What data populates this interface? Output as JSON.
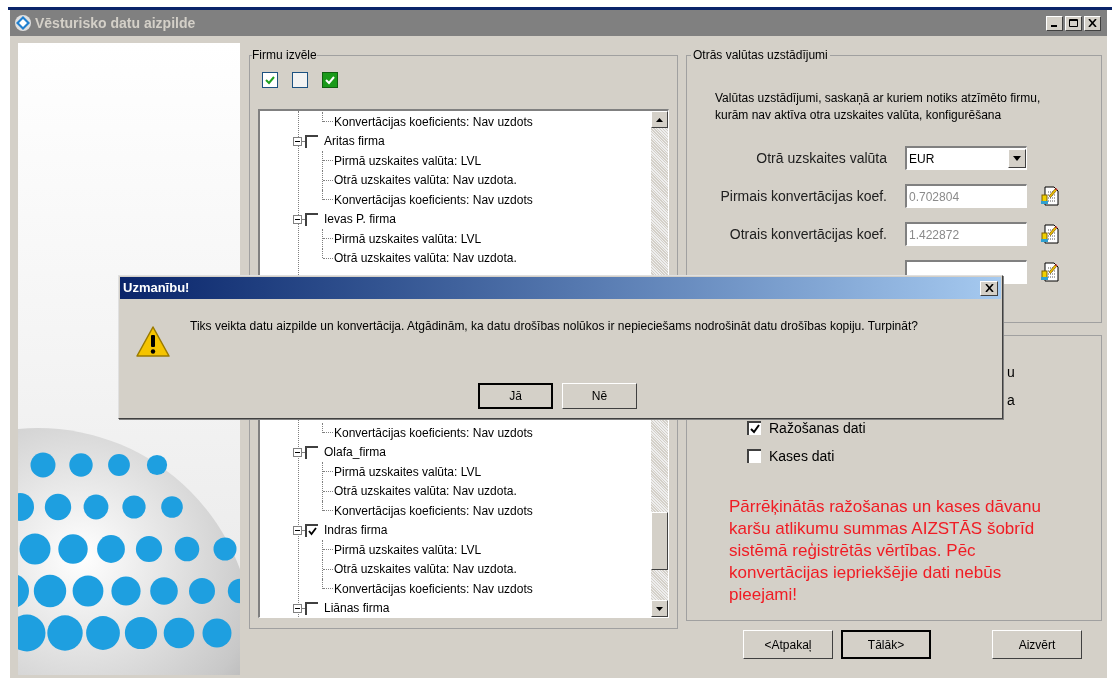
{
  "window": {
    "title": "Vēsturisko datu aizpilde"
  },
  "firm_selection": {
    "title": "Firmu izvēle",
    "tree": {
      "rows_above": [
        {
          "children": [
            "Konvertācijas koeficients: Nav uzdots"
          ]
        },
        {
          "label": "Aritas firma",
          "expanded": true,
          "checked": false,
          "children": [
            "Pirmā uzskaites valūta: LVL",
            "Otrā uzskaites valūta: Nav uzdota.",
            "Konvertācijas koeficients: Nav uzdots"
          ]
        },
        {
          "label": "Ievas P. firma",
          "expanded": true,
          "checked": false,
          "children": [
            "Pirmā uzskaites valūta: LVL",
            "Otrā uzskaites valūta: Nav uzdota."
          ]
        }
      ],
      "rows_below": [
        {
          "children": [
            "Konvertācijas koeficients: Nav uzdots"
          ]
        },
        {
          "label": "Olafa_firma",
          "expanded": true,
          "checked": false,
          "children": [
            "Pirmā uzskaites valūta: LVL",
            "Otrā uzskaites valūta: Nav uzdota.",
            "Konvertācijas koeficients: Nav uzdots"
          ]
        },
        {
          "label": "Indras firma",
          "expanded": true,
          "checked": true,
          "children": [
            "Pirmā uzskaites valūta: LVL",
            "Otrā uzskaites valūta: Nav uzdota.",
            "Konvertācijas koeficients: Nav uzdots"
          ]
        },
        {
          "label": "Liānas firma",
          "expanded": true,
          "checked": false
        }
      ]
    }
  },
  "currency_settings": {
    "title": "Otrās valūtas uzstādījumi",
    "description": "Valūtas uzstādījumi, saskaņā ar kuriem notiks atzīmēto firmu, kurām nav aktīva otra uzskaites valūta, konfigurēšana",
    "fields": [
      {
        "kind": "select",
        "label": "Otrā uzskaites valūta",
        "value": "EUR"
      },
      {
        "kind": "number",
        "label": "Pirmais konvertācijas koef.",
        "value": "0.702804",
        "disabled": true
      },
      {
        "kind": "number",
        "label": "Otrais konvertācijas koef.",
        "value": "1.422872",
        "disabled": true
      },
      {
        "kind": "number"
      }
    ]
  },
  "data_options": {
    "rows": [
      {
        "kind": "fragment",
        "text": "u"
      },
      {
        "kind": "fragment",
        "text": "a"
      },
      {
        "kind": "checkbox",
        "label": "Ražošanas dati",
        "checked": true
      },
      {
        "kind": "checkbox",
        "label": "Kases dati",
        "checked": false
      }
    ],
    "warning": "Pārrēķinātās ražošanas un kases dāvanu karšu atlikumu summas AIZSTĀS šobrīd sistēmā reģistrētās vērtības. Pēc konvertācijas iepriekšējie dati nebūs pieejami!"
  },
  "buttons": [
    {
      "label": "<Atpakaļ",
      "default": false
    },
    {
      "label": "Tālāk>",
      "default": true
    },
    {
      "label": "Aizvērt",
      "default": false
    }
  ],
  "dialog": {
    "title": "Uzmanību!",
    "message": "Tiks veikta datu aizpilde un konvertācija. Atgādinām, ka datu drošības nolūkos ir nepieciešams nodrošināt datu drošības kopiju. Turpināt?",
    "buttons": [
      {
        "label": "Jā",
        "default": true
      },
      {
        "label": "Nē",
        "default": false
      }
    ]
  }
}
